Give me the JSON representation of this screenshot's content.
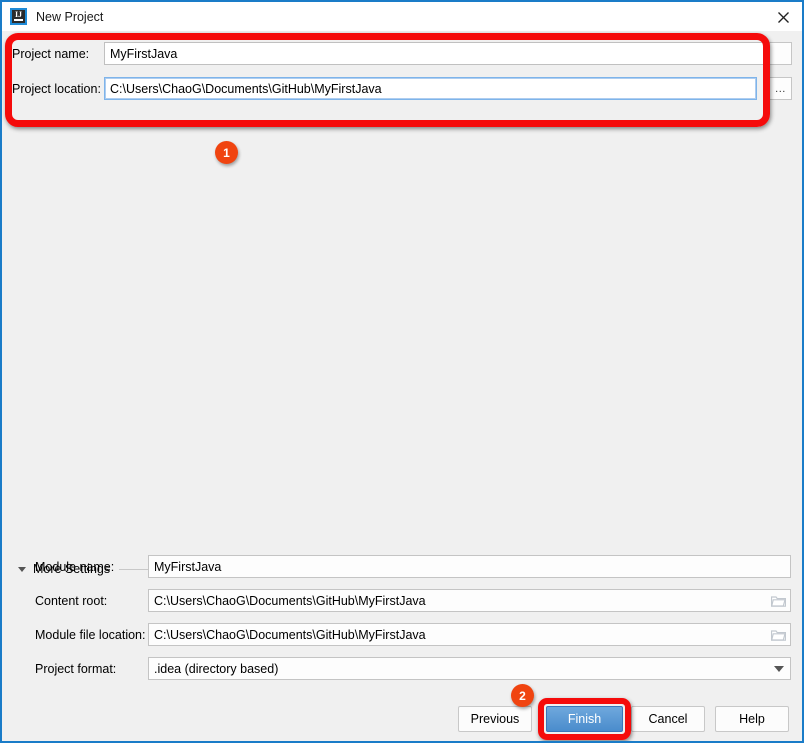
{
  "window": {
    "title": "New Project",
    "app_icon": "intellij-idea-icon",
    "close_icon": "close-icon",
    "border_color": "#1a7cc8"
  },
  "top_form": {
    "fields": [
      {
        "label": "Project name:",
        "value": "MyFirstJava",
        "focused": false,
        "browse_label": "..."
      },
      {
        "label": "Project location:",
        "value": "C:\\Users\\ChaoG\\Documents\\GitHub\\MyFirstJava",
        "focused": true,
        "browse_label": "..."
      }
    ]
  },
  "more_settings": {
    "label": "More Settings",
    "expanded": true,
    "collapse_icon": "chevron-down-icon",
    "rows": [
      {
        "label": "Module name:",
        "value": "MyFirstJava",
        "trailing_icon": "none"
      },
      {
        "label": "Content root:",
        "value": "C:\\Users\\ChaoG\\Documents\\GitHub\\MyFirstJava",
        "trailing_icon": "folder-icon"
      },
      {
        "label": "Module file location:",
        "value": "C:\\Users\\ChaoG\\Documents\\GitHub\\MyFirstJava",
        "trailing_icon": "folder-icon"
      },
      {
        "label": "Project format:",
        "value": ".idea (directory based)",
        "trailing_icon": "chevron-down-icon"
      }
    ]
  },
  "buttons": {
    "previous": "Previous",
    "finish": "Finish",
    "cancel": "Cancel",
    "help": "Help"
  },
  "annotations": {
    "highlight_color": "#f50b0b",
    "badge_color": "#f04410",
    "steps": [
      {
        "number": "1",
        "target": "project-fields-group"
      },
      {
        "number": "2",
        "target": "finish-button"
      }
    ]
  }
}
